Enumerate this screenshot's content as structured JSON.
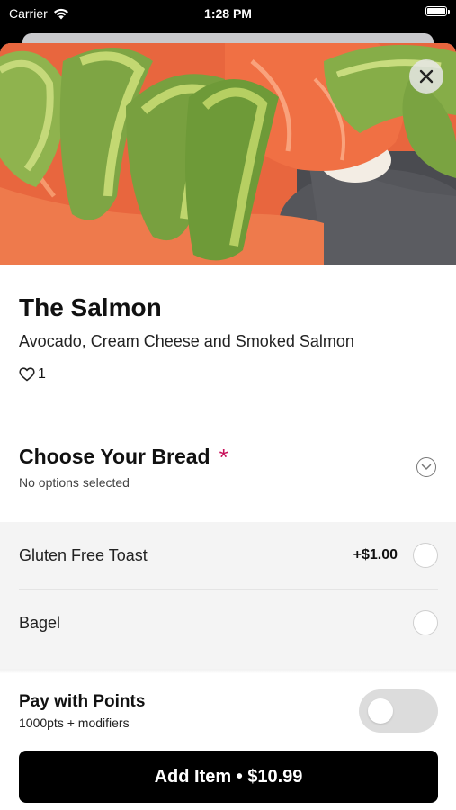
{
  "status_bar": {
    "carrier": "Carrier",
    "time": "1:28 PM"
  },
  "item": {
    "title": "The Salmon",
    "description": "Avocado, Cream Cheese and Smoked Salmon",
    "likes": "1",
    "image_icon": "salmon-avocado-photo"
  },
  "bread_section": {
    "title": "Choose Your Bread",
    "required_mark": "*",
    "subtitle": "No options selected",
    "options": [
      {
        "label": "Gluten Free Toast",
        "price": "+$1.00",
        "selected": false
      },
      {
        "label": "Bagel",
        "price": "",
        "selected": false
      }
    ]
  },
  "points": {
    "title": "Pay with Points",
    "subtitle": "1000pts + modifiers",
    "enabled": false
  },
  "cta": {
    "label": "Add Item • $10.99"
  },
  "colors": {
    "accent_required": "#c8105a",
    "button_bg": "#000000",
    "option_bg": "#f4f4f4"
  }
}
